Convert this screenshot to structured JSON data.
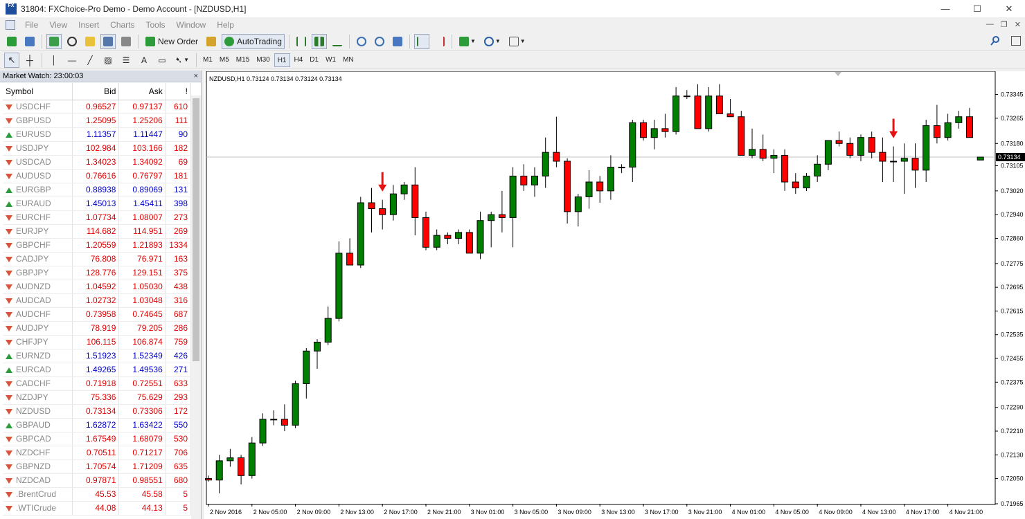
{
  "window": {
    "title": "31804: FXChoice-Pro Demo - Demo Account - [NZDUSD,H1]",
    "app_icon_text": "FX",
    "minimize": "—",
    "maximize": "☐",
    "close": "✕"
  },
  "menu": {
    "items": [
      "File",
      "View",
      "Insert",
      "Charts",
      "Tools",
      "Window",
      "Help"
    ],
    "right_controls": [
      "—",
      "❐",
      "✕"
    ]
  },
  "toolbar": {
    "new_order_label": "New Order",
    "autotrading_label": "AutoTrading"
  },
  "timeframes": [
    "M1",
    "M5",
    "M15",
    "M30",
    "H1",
    "H4",
    "D1",
    "W1",
    "MN"
  ],
  "active_timeframe": "H1",
  "market_watch": {
    "title": "Market Watch: 23:00:03",
    "close": "×",
    "columns": [
      "Symbol",
      "Bid",
      "Ask",
      "!"
    ],
    "rows": [
      {
        "symbol": "USDCHF",
        "bid": "0.96527",
        "ask": "0.97137",
        "spread": "610",
        "dir": "down"
      },
      {
        "symbol": "GBPUSD",
        "bid": "1.25095",
        "ask": "1.25206",
        "spread": "111",
        "dir": "down"
      },
      {
        "symbol": "EURUSD",
        "bid": "1.11357",
        "ask": "1.11447",
        "spread": "90",
        "dir": "up"
      },
      {
        "symbol": "USDJPY",
        "bid": "102.984",
        "ask": "103.166",
        "spread": "182",
        "dir": "down"
      },
      {
        "symbol": "USDCAD",
        "bid": "1.34023",
        "ask": "1.34092",
        "spread": "69",
        "dir": "down"
      },
      {
        "symbol": "AUDUSD",
        "bid": "0.76616",
        "ask": "0.76797",
        "spread": "181",
        "dir": "down"
      },
      {
        "symbol": "EURGBP",
        "bid": "0.88938",
        "ask": "0.89069",
        "spread": "131",
        "dir": "up"
      },
      {
        "symbol": "EURAUD",
        "bid": "1.45013",
        "ask": "1.45411",
        "spread": "398",
        "dir": "up"
      },
      {
        "symbol": "EURCHF",
        "bid": "1.07734",
        "ask": "1.08007",
        "spread": "273",
        "dir": "down"
      },
      {
        "symbol": "EURJPY",
        "bid": "114.682",
        "ask": "114.951",
        "spread": "269",
        "dir": "down"
      },
      {
        "symbol": "GBPCHF",
        "bid": "1.20559",
        "ask": "1.21893",
        "spread": "1334",
        "dir": "down"
      },
      {
        "symbol": "CADJPY",
        "bid": "76.808",
        "ask": "76.971",
        "spread": "163",
        "dir": "down"
      },
      {
        "symbol": "GBPJPY",
        "bid": "128.776",
        "ask": "129.151",
        "spread": "375",
        "dir": "down"
      },
      {
        "symbol": "AUDNZD",
        "bid": "1.04592",
        "ask": "1.05030",
        "spread": "438",
        "dir": "down"
      },
      {
        "symbol": "AUDCAD",
        "bid": "1.02732",
        "ask": "1.03048",
        "spread": "316",
        "dir": "down"
      },
      {
        "symbol": "AUDCHF",
        "bid": "0.73958",
        "ask": "0.74645",
        "spread": "687",
        "dir": "down"
      },
      {
        "symbol": "AUDJPY",
        "bid": "78.919",
        "ask": "79.205",
        "spread": "286",
        "dir": "down"
      },
      {
        "symbol": "CHFJPY",
        "bid": "106.115",
        "ask": "106.874",
        "spread": "759",
        "dir": "down"
      },
      {
        "symbol": "EURNZD",
        "bid": "1.51923",
        "ask": "1.52349",
        "spread": "426",
        "dir": "up"
      },
      {
        "symbol": "EURCAD",
        "bid": "1.49265",
        "ask": "1.49536",
        "spread": "271",
        "dir": "up"
      },
      {
        "symbol": "CADCHF",
        "bid": "0.71918",
        "ask": "0.72551",
        "spread": "633",
        "dir": "down"
      },
      {
        "symbol": "NZDJPY",
        "bid": "75.336",
        "ask": "75.629",
        "spread": "293",
        "dir": "down"
      },
      {
        "symbol": "NZDUSD",
        "bid": "0.73134",
        "ask": "0.73306",
        "spread": "172",
        "dir": "down"
      },
      {
        "symbol": "GBPAUD",
        "bid": "1.62872",
        "ask": "1.63422",
        "spread": "550",
        "dir": "up"
      },
      {
        "symbol": "GBPCAD",
        "bid": "1.67549",
        "ask": "1.68079",
        "spread": "530",
        "dir": "down"
      },
      {
        "symbol": "NZDCHF",
        "bid": "0.70511",
        "ask": "0.71217",
        "spread": "706",
        "dir": "down"
      },
      {
        "symbol": "GBPNZD",
        "bid": "1.70574",
        "ask": "1.71209",
        "spread": "635",
        "dir": "down"
      },
      {
        "symbol": "NZDCAD",
        "bid": "0.97871",
        "ask": "0.98551",
        "spread": "680",
        "dir": "down"
      },
      {
        "symbol": ".BrentCrud",
        "bid": "45.53",
        "ask": "45.58",
        "spread": "5",
        "dir": "down"
      },
      {
        "symbol": ".WTICrude",
        "bid": "44.08",
        "ask": "44.13",
        "spread": "5",
        "dir": "down"
      }
    ]
  },
  "colors": {
    "bull": "#008000",
    "bear": "#ff0000",
    "bid_up": "#0000cc",
    "bid_down": "#e00000",
    "arrow": "#e81010",
    "price_tag": "#000000"
  },
  "chart_data": {
    "type": "candlestick",
    "title": "NZDUSD,H1  0.73124 0.73134 0.73124 0.73134",
    "current_price": "0.73134",
    "ylim": [
      0.71965,
      0.734
    ],
    "y_ticks": [
      "0.73345",
      "0.73265",
      "0.73180",
      "0.73105",
      "0.73020",
      "0.72940",
      "0.72860",
      "0.72775",
      "0.72695",
      "0.72615",
      "0.72535",
      "0.72455",
      "0.72375",
      "0.72290",
      "0.72210",
      "0.72130",
      "0.72050",
      "0.71965"
    ],
    "x_labels": [
      "2 Nov 2016",
      "2 Nov 05:00",
      "2 Nov 09:00",
      "2 Nov 13:00",
      "2 Nov 17:00",
      "2 Nov 21:00",
      "3 Nov 01:00",
      "3 Nov 05:00",
      "3 Nov 09:00",
      "3 Nov 13:00",
      "3 Nov 17:00",
      "3 Nov 21:00",
      "4 Nov 01:00",
      "4 Nov 05:00",
      "4 Nov 09:00",
      "4 Nov 13:00",
      "4 Nov 17:00",
      "4 Nov 21:00"
    ],
    "candles": [
      [
        0.7205,
        0.7206,
        0.7204,
        0.72045
      ],
      [
        0.72045,
        0.7213,
        0.72,
        0.7211
      ],
      [
        0.7211,
        0.7215,
        0.7209,
        0.7212
      ],
      [
        0.7212,
        0.7213,
        0.7203,
        0.7206
      ],
      [
        0.7206,
        0.7219,
        0.7205,
        0.7217
      ],
      [
        0.7217,
        0.7227,
        0.7216,
        0.7225
      ],
      [
        0.7225,
        0.7228,
        0.7223,
        0.7225
      ],
      [
        0.7225,
        0.723,
        0.7221,
        0.7223
      ],
      [
        0.7223,
        0.7238,
        0.7222,
        0.7237
      ],
      [
        0.7237,
        0.7249,
        0.7232,
        0.7248
      ],
      [
        0.7248,
        0.7252,
        0.7242,
        0.7251
      ],
      [
        0.7251,
        0.7263,
        0.725,
        0.7259
      ],
      [
        0.7259,
        0.7285,
        0.7258,
        0.7281
      ],
      [
        0.7281,
        0.7286,
        0.7277,
        0.7277
      ],
      [
        0.7277,
        0.73,
        0.7276,
        0.7298
      ],
      [
        0.7298,
        0.7303,
        0.7288,
        0.7296
      ],
      [
        0.7296,
        0.7299,
        0.7289,
        0.7294
      ],
      [
        0.7294,
        0.7304,
        0.7292,
        0.7301
      ],
      [
        0.7301,
        0.7305,
        0.7299,
        0.7304
      ],
      [
        0.7304,
        0.731,
        0.7287,
        0.7293
      ],
      [
        0.7293,
        0.7295,
        0.7282,
        0.7283
      ],
      [
        0.7283,
        0.7289,
        0.7282,
        0.7287
      ],
      [
        0.7287,
        0.7288,
        0.7284,
        0.7286
      ],
      [
        0.7286,
        0.7289,
        0.7284,
        0.7288
      ],
      [
        0.7288,
        0.7289,
        0.7281,
        0.7281
      ],
      [
        0.7281,
        0.7295,
        0.7279,
        0.7292
      ],
      [
        0.7292,
        0.7295,
        0.7283,
        0.7294
      ],
      [
        0.7294,
        0.7302,
        0.7288,
        0.7293
      ],
      [
        0.7293,
        0.731,
        0.7283,
        0.7307
      ],
      [
        0.7307,
        0.7311,
        0.7302,
        0.7304
      ],
      [
        0.7304,
        0.731,
        0.73,
        0.7307
      ],
      [
        0.7307,
        0.732,
        0.7303,
        0.7315
      ],
      [
        0.7315,
        0.7327,
        0.731,
        0.7312
      ],
      [
        0.7312,
        0.7313,
        0.7291,
        0.7295
      ],
      [
        0.7295,
        0.7301,
        0.729,
        0.73
      ],
      [
        0.73,
        0.7309,
        0.7296,
        0.7305
      ],
      [
        0.7305,
        0.7307,
        0.7298,
        0.7302
      ],
      [
        0.7302,
        0.7314,
        0.7299,
        0.731
      ],
      [
        0.731,
        0.7311,
        0.7308,
        0.731
      ],
      [
        0.731,
        0.7326,
        0.7305,
        0.7325
      ],
      [
        0.7325,
        0.7326,
        0.7319,
        0.732
      ],
      [
        0.732,
        0.7326,
        0.7316,
        0.7323
      ],
      [
        0.7323,
        0.7328,
        0.732,
        0.7322
      ],
      [
        0.7322,
        0.7337,
        0.7321,
        0.7334
      ],
      [
        0.7334,
        0.7336,
        0.7333,
        0.7334
      ],
      [
        0.7334,
        0.7338,
        0.7323,
        0.7323
      ],
      [
        0.7323,
        0.7337,
        0.7322,
        0.7334
      ],
      [
        0.7334,
        0.7338,
        0.7328,
        0.7328
      ],
      [
        0.7328,
        0.7333,
        0.7327,
        0.7327
      ],
      [
        0.7327,
        0.7329,
        0.7314,
        0.7314
      ],
      [
        0.7314,
        0.7323,
        0.7313,
        0.7316
      ],
      [
        0.7316,
        0.7321,
        0.7312,
        0.7313
      ],
      [
        0.7313,
        0.7316,
        0.7308,
        0.7314
      ],
      [
        0.7314,
        0.7316,
        0.7302,
        0.7305
      ],
      [
        0.7305,
        0.7308,
        0.7301,
        0.7303
      ],
      [
        0.7303,
        0.7308,
        0.7302,
        0.7307
      ],
      [
        0.7307,
        0.7314,
        0.7305,
        0.7311
      ],
      [
        0.7311,
        0.7319,
        0.7309,
        0.7319
      ],
      [
        0.7319,
        0.7322,
        0.7317,
        0.7318
      ],
      [
        0.7318,
        0.732,
        0.7313,
        0.7314
      ],
      [
        0.7314,
        0.7321,
        0.7312,
        0.732
      ],
      [
        0.732,
        0.7322,
        0.7313,
        0.7315
      ],
      [
        0.7315,
        0.732,
        0.7305,
        0.7312
      ],
      [
        0.7312,
        0.7317,
        0.7305,
        0.7312
      ],
      [
        0.7312,
        0.7318,
        0.7301,
        0.7313
      ],
      [
        0.7313,
        0.7318,
        0.7303,
        0.7309
      ],
      [
        0.7309,
        0.7326,
        0.7305,
        0.7324
      ],
      [
        0.7324,
        0.7331,
        0.7318,
        0.732
      ],
      [
        0.732,
        0.7328,
        0.7319,
        0.7325
      ],
      [
        0.7325,
        0.7329,
        0.7323,
        0.7327
      ],
      [
        0.7327,
        0.733,
        0.732,
        0.732
      ],
      [
        0.73124,
        0.73134,
        0.73124,
        0.73134
      ]
    ],
    "annotations": [
      {
        "type": "down-arrow",
        "candle": 16
      },
      {
        "type": "down-arrow",
        "candle": 63
      }
    ]
  }
}
